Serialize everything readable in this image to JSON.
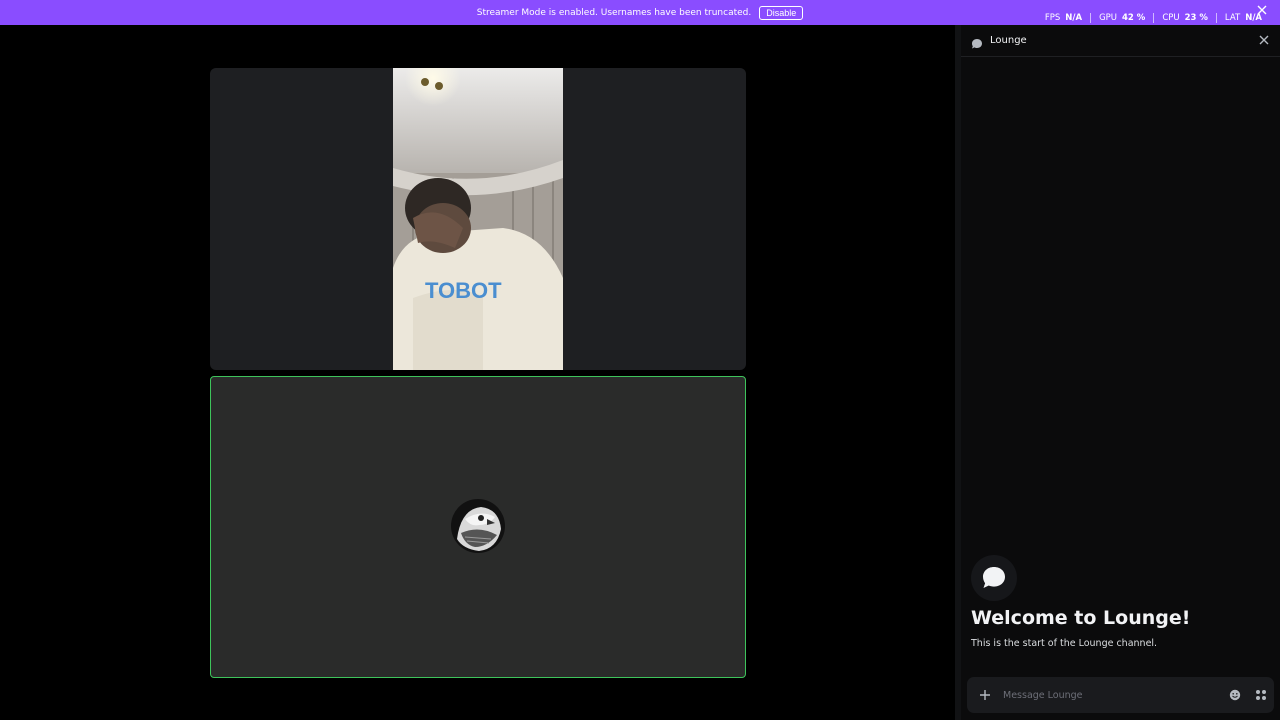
{
  "banner": {
    "text": "Streamer Mode is enabled. Usernames have been truncated.",
    "button_label": "Disable",
    "color": "#8a4dff"
  },
  "stats": [
    {
      "label": "FPS",
      "value": "N/A"
    },
    {
      "label": "GPU",
      "value": "42 %"
    },
    {
      "label": "CPU",
      "value": "23 %"
    },
    {
      "label": "LAT",
      "value": "N/A"
    }
  ],
  "stage": {
    "speaking_border_color": "#3ec45b"
  },
  "chat": {
    "channel_name": "Lounge",
    "welcome_title": "Welcome to Lounge!",
    "welcome_subtitle": "This is the start of the Lounge channel.",
    "composer_placeholder": "Message Lounge"
  },
  "icons": [
    "close-icon",
    "chat-bubble-icon",
    "plus-icon",
    "emoji-icon",
    "apps-icon"
  ]
}
